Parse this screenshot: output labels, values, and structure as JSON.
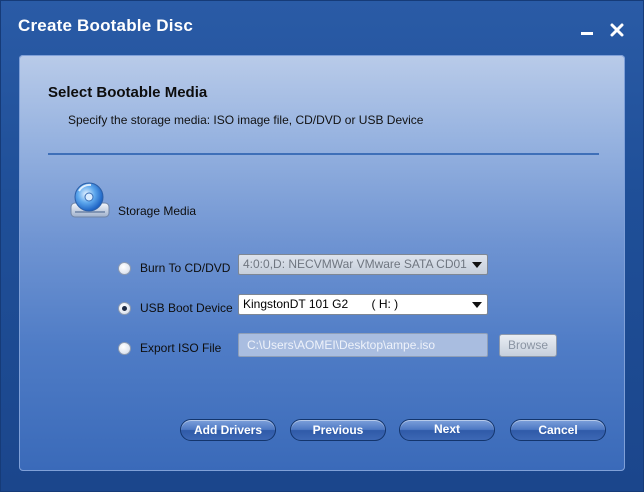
{
  "window": {
    "title": "Create Bootable Disc"
  },
  "header": {
    "title": "Select Bootable Media",
    "subtitle": "Specify the storage media: ISO image file, CD/DVD or USB Device"
  },
  "storage": {
    "label": "Storage Media",
    "options": [
      {
        "label": "Burn To CD/DVD",
        "selected": false,
        "value": "4:0:0,D: NECVMWar VMware SATA CD01",
        "enabled": false
      },
      {
        "label": "USB Boot Device",
        "selected": true,
        "value": "KingstonDT 101 G2       ( H: )",
        "enabled": true
      },
      {
        "label": "Export ISO File",
        "selected": false,
        "value": "C:\\Users\\AOMEI\\Desktop\\ampe.iso",
        "enabled": false
      }
    ],
    "browse_label": "Browse"
  },
  "buttons": {
    "add_drivers": "Add Drivers",
    "previous": "Previous",
    "next": "Next",
    "cancel": "Cancel"
  },
  "colors": {
    "window_bg": "#2a5ba6",
    "panel_top": "#b9cbe9",
    "panel_bottom": "#3a6ab9",
    "button": "#4d78c3"
  },
  "icons": {
    "media": "disc-drive-icon",
    "minimize": "minimize-icon",
    "close": "close-icon"
  }
}
